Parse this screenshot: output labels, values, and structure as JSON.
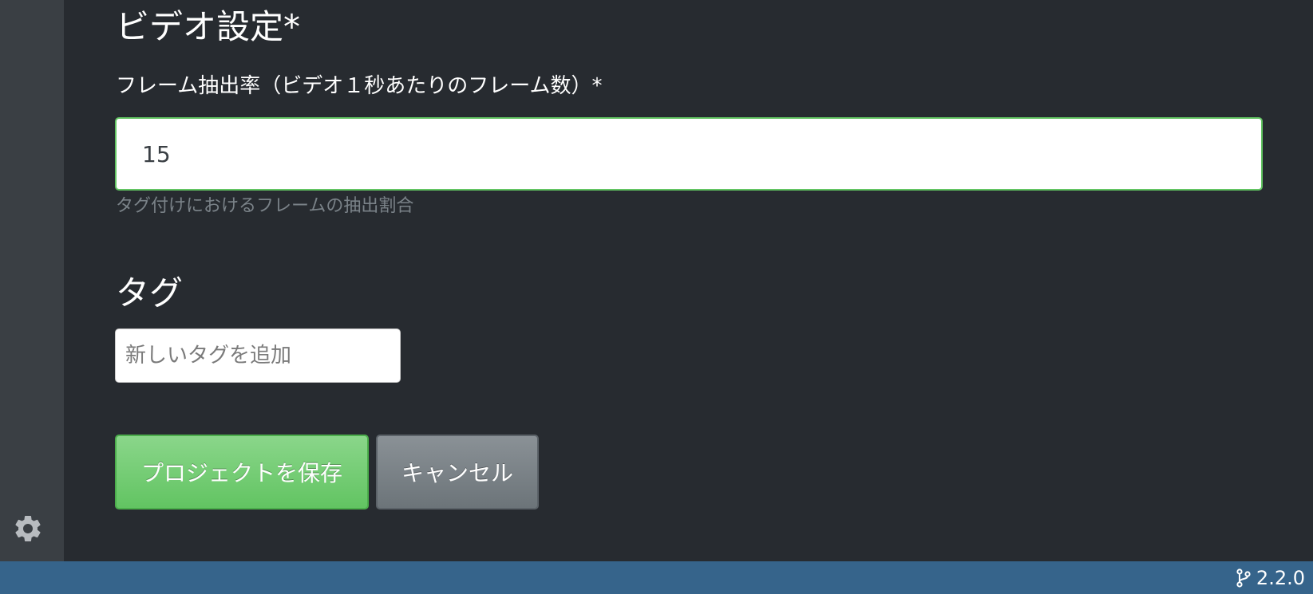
{
  "sidebar": {
    "settings_icon": "gear-icon"
  },
  "video_settings": {
    "title": "ビデオ設定*",
    "frame_rate_label": "フレーム抽出率（ビデオ１秒あたりのフレーム数）*",
    "frame_rate_value": "15",
    "frame_rate_help": "タグ付けにおけるフレームの抽出割合"
  },
  "tags": {
    "title": "タグ",
    "input_placeholder": "新しいタグを追加"
  },
  "actions": {
    "save_label": "プロジェクトを保存",
    "cancel_label": "キャンセル"
  },
  "statusbar": {
    "version": "2.2.0",
    "version_icon": "git-branch-icon"
  },
  "colors": {
    "background": "#272b30",
    "sidebar": "#3a3f44",
    "statusbar": "#36648b",
    "success": "#62c462",
    "secondary": "#7a8288"
  }
}
